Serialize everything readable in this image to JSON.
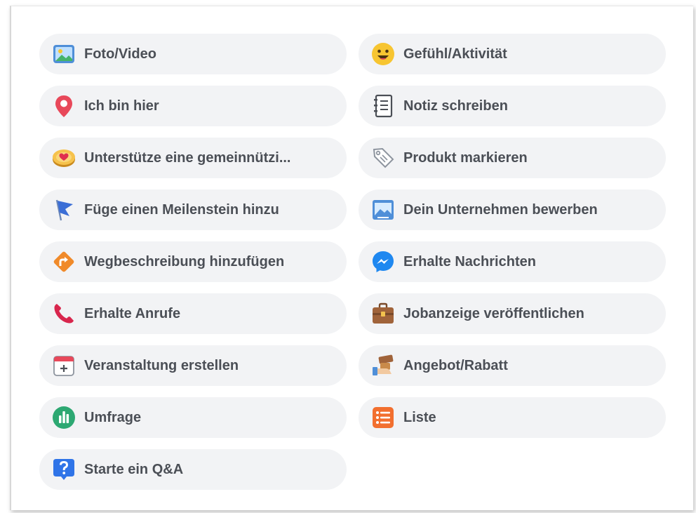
{
  "options": [
    {
      "label": "Foto/Video",
      "icon": "photo-icon"
    },
    {
      "label": "Gefühl/Aktivität",
      "icon": "smiley-icon"
    },
    {
      "label": "Ich bin hier",
      "icon": "location-pin-icon"
    },
    {
      "label": "Notiz schreiben",
      "icon": "notebook-icon"
    },
    {
      "label": "Unterstütze eine gemeinnützi...",
      "icon": "heart-badge-icon"
    },
    {
      "label": "Produkt markieren",
      "icon": "price-tag-icon"
    },
    {
      "label": "Füge einen Meilenstein hinzu",
      "icon": "flag-icon"
    },
    {
      "label": "Dein Unternehmen bewerben",
      "icon": "promote-business-icon"
    },
    {
      "label": "Wegbeschreibung hinzufügen",
      "icon": "directions-icon"
    },
    {
      "label": "Erhalte Nachrichten",
      "icon": "messenger-icon"
    },
    {
      "label": "Erhalte Anrufe",
      "icon": "phone-icon"
    },
    {
      "label": "Jobanzeige veröffentlichen",
      "icon": "briefcase-icon"
    },
    {
      "label": "Veranstaltung erstellen",
      "icon": "calendar-icon"
    },
    {
      "label": "Angebot/Rabatt",
      "icon": "offer-icon"
    },
    {
      "label": "Umfrage",
      "icon": "poll-icon"
    },
    {
      "label": "Liste",
      "icon": "list-icon"
    },
    {
      "label": "Starte ein Q&A",
      "icon": "question-icon"
    }
  ],
  "colors": {
    "pill_background": "#f2f3f5",
    "label_text": "#4b4f56",
    "photo_blue": "#4f8fd8",
    "smiley_yellow": "#f7c531",
    "pin_red": "#e8485a",
    "heart_red": "#e0304e",
    "flag_blue": "#3b6ed6",
    "directions_orange": "#f08a2a",
    "messenger_blue": "#1f88f0",
    "phone_red": "#d8264d",
    "poll_green": "#2da872",
    "list_orange": "#f26f2f",
    "question_blue": "#2f74e8"
  }
}
